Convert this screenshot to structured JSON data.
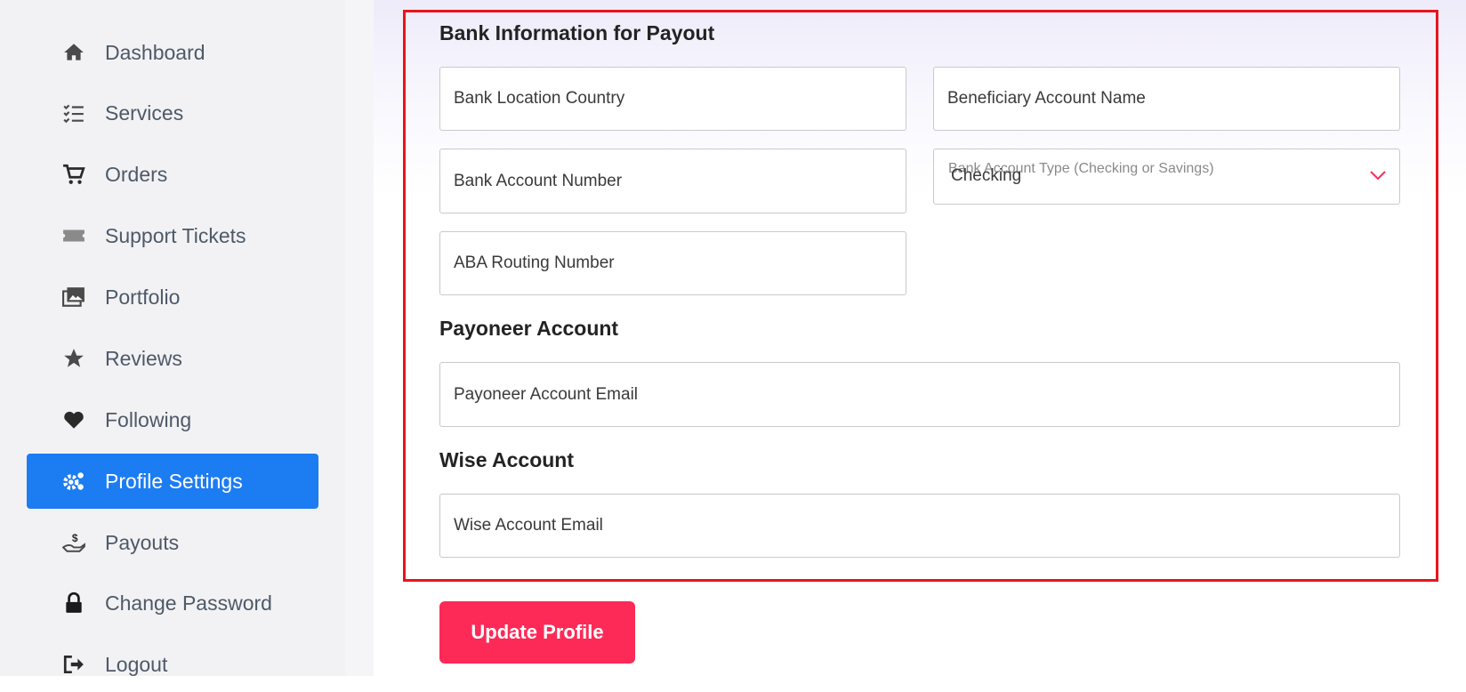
{
  "sidebar": {
    "items": [
      {
        "label": "Dashboard",
        "icon": "home-icon",
        "active": false
      },
      {
        "label": "Services",
        "icon": "checklist-icon",
        "active": false
      },
      {
        "label": "Orders",
        "icon": "cart-icon",
        "active": false
      },
      {
        "label": "Support Tickets",
        "icon": "ticket-icon",
        "active": false
      },
      {
        "label": "Portfolio",
        "icon": "images-icon",
        "active": false
      },
      {
        "label": "Reviews",
        "icon": "star-icon",
        "active": false
      },
      {
        "label": "Following",
        "icon": "heart-icon",
        "active": false
      },
      {
        "label": "Profile Settings",
        "icon": "gears-icon",
        "active": true
      },
      {
        "label": "Payouts",
        "icon": "payout-hand-icon",
        "active": false
      },
      {
        "label": "Change Password",
        "icon": "lock-icon",
        "active": false
      },
      {
        "label": "Logout",
        "icon": "logout-icon",
        "active": false
      }
    ],
    "active_color": "#1c7cf2"
  },
  "bank": {
    "title": "Bank Information for Payout",
    "location_country": "Bank Location Country",
    "beneficiary_name": "Beneficiary Account Name",
    "account_number": "Bank Account Number",
    "account_type_label": "Bank Account Type (Checking or Savings)",
    "account_type_value": "Checking",
    "routing_number": "ABA Routing Number"
  },
  "payoneer": {
    "title": "Payoneer Account",
    "email": "Payoneer Account Email"
  },
  "wise": {
    "title": "Wise Account",
    "email": "Wise Account Email"
  },
  "update_button": "Update Profile",
  "colors": {
    "highlight_border": "#e8141c",
    "button": "#fd2a57",
    "chevron": "#fd2a57"
  }
}
